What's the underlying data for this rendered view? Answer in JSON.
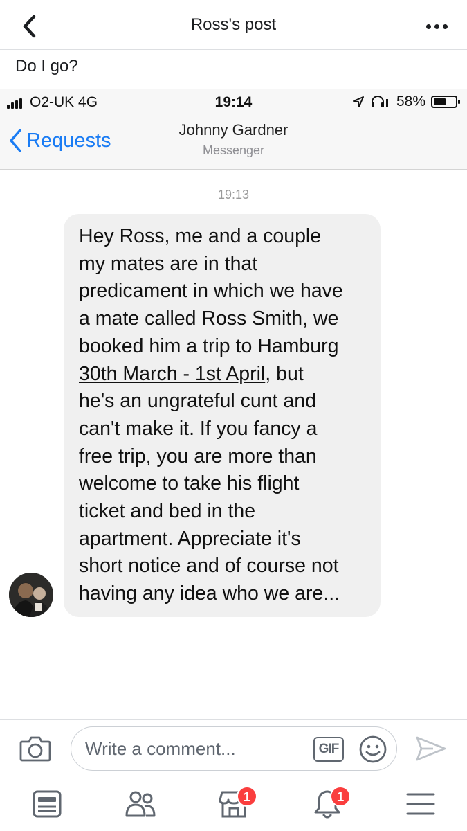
{
  "header": {
    "title": "Ross's post"
  },
  "post": {
    "caption": "Do I go?"
  },
  "screenshot": {
    "status_bar": {
      "carrier": "O2-UK  4G",
      "time": "19:14",
      "battery": "58%",
      "battery_level": 0.58
    },
    "nav": {
      "back_label": "Requests",
      "contact_name": "Johnny Gardner",
      "subtitle": "Messenger"
    },
    "timestamp": "19:13",
    "message_lines": [
      "Hey Ross, me and a couple",
      "my mates are in that",
      "predicament in which we have",
      "a mate called Ross Smith, we",
      "booked him a trip to Hamburg",
      "30th March - 1st April",
      ", but",
      "he's an ungrateful cunt and",
      "can't make it. If you fancy a",
      "free trip, you are more than",
      "welcome to take his flight",
      "ticket and bed in the",
      "apartment. Appreciate it's",
      "short notice and of course not",
      "having any idea who we are..."
    ]
  },
  "comment_bar": {
    "placeholder": "Write a comment...",
    "gif_label": "GIF"
  },
  "tab_bar": {
    "tabs": [
      {
        "name": "news-feed",
        "icon": "news-feed-icon",
        "badge": ""
      },
      {
        "name": "friends",
        "icon": "friends-icon",
        "badge": ""
      },
      {
        "name": "marketplace",
        "icon": "marketplace-icon",
        "badge": "1"
      },
      {
        "name": "notifications",
        "icon": "bell-icon",
        "badge": "1"
      },
      {
        "name": "menu",
        "icon": "menu-icon",
        "badge": ""
      }
    ]
  },
  "colors": {
    "messenger_blue": "#1a7cf4",
    "badge_red": "#fa3e3e",
    "bubble_gray": "#f0f0f0"
  }
}
